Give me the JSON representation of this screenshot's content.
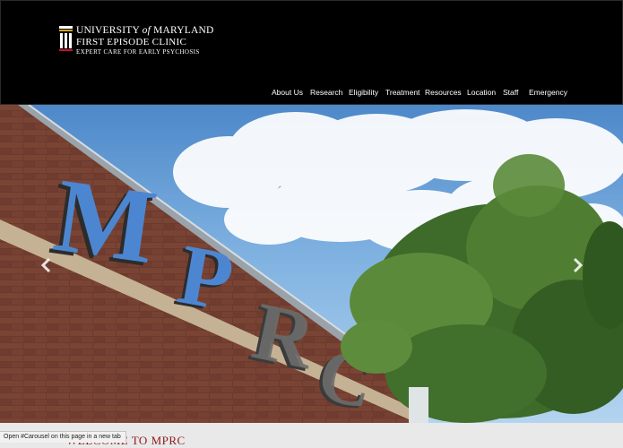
{
  "logo": {
    "line1_prefix": "UNIVERSITY",
    "line1_of": "of",
    "line1_suffix": "MARYLAND",
    "line2": "FIRST EPISODE CLINIC",
    "line3": "Expert Care For Early Psychosis",
    "icon": "university-building-icon"
  },
  "nav": {
    "items": [
      {
        "label": "About Us"
      },
      {
        "label": "Research"
      },
      {
        "label": "Eligibility"
      },
      {
        "label": "Treatment"
      },
      {
        "label": "Resources"
      },
      {
        "label": "Location"
      },
      {
        "label": "Staff"
      },
      {
        "label": "Emergency"
      }
    ]
  },
  "carousel": {
    "sign_letters": [
      "M",
      "P",
      "R",
      "C"
    ],
    "prev_icon": "chevron-left-icon",
    "next_icon": "chevron-right-icon"
  },
  "welcome": {
    "title": "WELCOME TO MPRC"
  },
  "status_bar": {
    "text": "Open #Carousel on this page in a new tab"
  },
  "colors": {
    "header_bg": "#000000",
    "welcome_text": "#8b1a1a",
    "sign_blue": "#4d86d0",
    "brick": "#6e3a2e"
  }
}
